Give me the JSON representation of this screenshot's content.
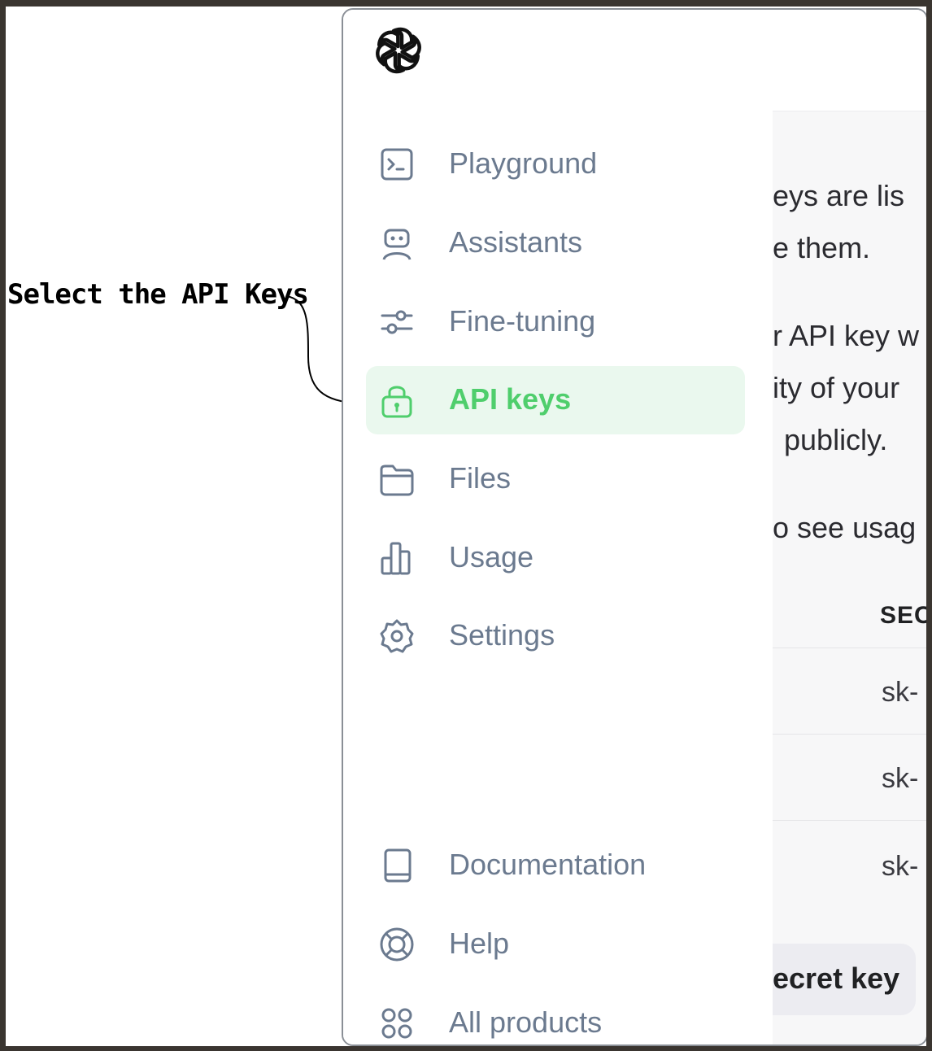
{
  "annotation": {
    "text": "Select the API Keys"
  },
  "sidebar": {
    "items": [
      {
        "label": "Playground",
        "icon": "terminal-icon"
      },
      {
        "label": "Assistants",
        "icon": "robot-icon"
      },
      {
        "label": "Fine-tuning",
        "icon": "sliders-icon"
      },
      {
        "label": "API keys",
        "icon": "lock-icon",
        "active": true
      },
      {
        "label": "Files",
        "icon": "folder-icon"
      },
      {
        "label": "Usage",
        "icon": "bar-chart-icon"
      },
      {
        "label": "Settings",
        "icon": "gear-icon"
      }
    ],
    "bottom_items": [
      {
        "label": "Documentation",
        "icon": "book-icon"
      },
      {
        "label": "Help",
        "icon": "lifebuoy-icon"
      },
      {
        "label": "All products",
        "icon": "grid-icon"
      }
    ]
  },
  "content": {
    "lines": [
      "eys are lis",
      "e them.",
      "r API key w",
      "ity of your",
      "publicly.",
      "o see usag"
    ],
    "table_header": "SEC",
    "rows": [
      "sk-",
      "sk-",
      "sk-"
    ],
    "create_button": "ecret key"
  },
  "colors": {
    "active_green": "#4fce6c",
    "active_bg": "#eaf8ee",
    "nav_text": "#6b7a8f"
  }
}
